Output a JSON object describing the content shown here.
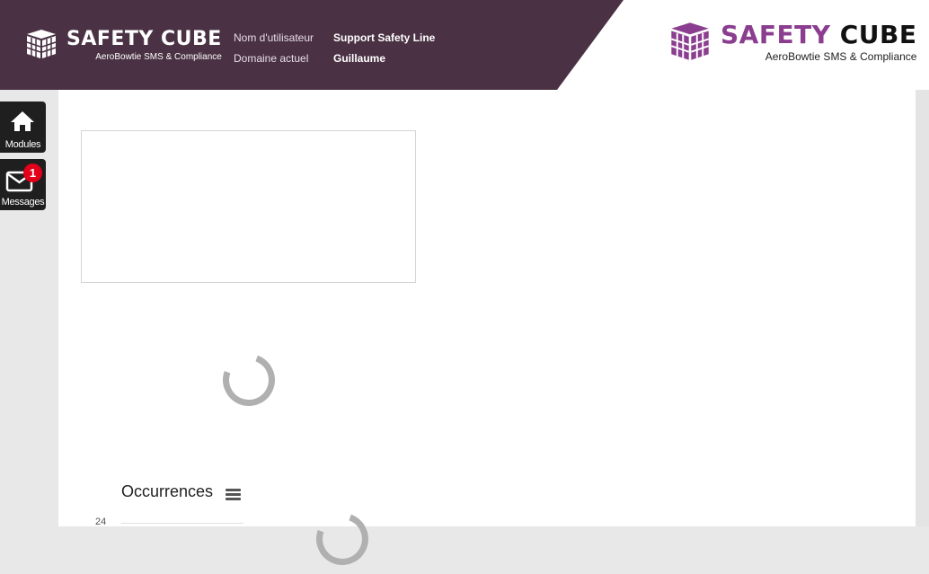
{
  "header": {
    "brand_left": "SAFETY CUBE",
    "tagline_left": "AeroBowtie SMS & Compliance",
    "user_label": "Nom d'utilisateur",
    "user_value": "Support Safety Line",
    "domain_label": "Domaine actuel",
    "domain_value": "Guillaume",
    "brand_right_part1": "SAFETY",
    "brand_right_part2": "CUBE",
    "tagline_right": "AeroBowtie SMS & Compliance",
    "band_color": "#4a3244",
    "accent_color": "#8b3d8f"
  },
  "sidebar": {
    "modules_label": "Modules",
    "modules_icon": "home-icon",
    "messages_label": "Messages",
    "messages_icon": "envelope-icon",
    "messages_badge": "1"
  },
  "main": {
    "chart_title": "Occurrences",
    "y_tick": "24"
  }
}
